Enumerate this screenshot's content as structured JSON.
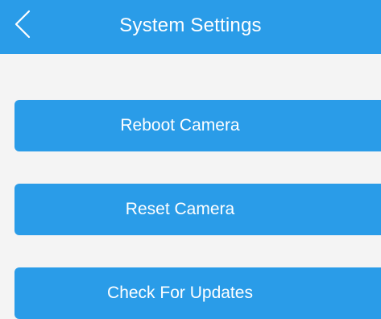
{
  "header": {
    "title": "System Settings",
    "back_icon": "chevron-left-icon"
  },
  "actions": [
    {
      "label": "Reboot Camera"
    },
    {
      "label": "Reset Camera"
    },
    {
      "label": "Check For Updates"
    }
  ],
  "colors": {
    "accent": "#2a9ce8",
    "background": "#f4f4f4",
    "text_on_accent": "#ffffff"
  }
}
